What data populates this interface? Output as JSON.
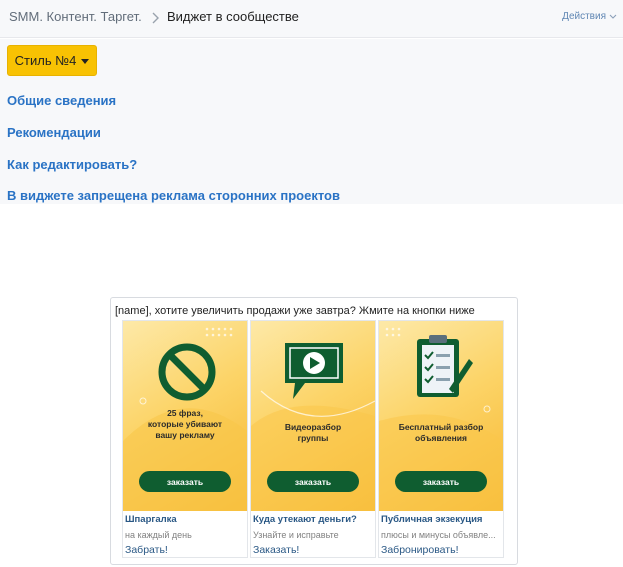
{
  "header": {
    "breadcrumb_parent": "SMM. Контент. Таргет.",
    "breadcrumb_current": "Виджет в сообществе",
    "actions_label": "Действия"
  },
  "style_button": {
    "label": "Стиль №4"
  },
  "sections": [
    {
      "label": "Общие сведения"
    },
    {
      "label": "Рекомендации"
    },
    {
      "label": "Как редактировать?"
    },
    {
      "label": "В виджете запрещена реклама сторонних проектов"
    }
  ],
  "widget": {
    "title": "[name], хотите увеличить продажи уже завтра? Жмите на кнопки ниже",
    "cards": [
      {
        "icon": "no-sign-icon",
        "caption": [
          "25 фраз,",
          "которые убивают",
          "вашу рекламу"
        ],
        "order_label": "заказать",
        "name": "Шпаргалка",
        "description": "на каждый день",
        "link": "Забрать!"
      },
      {
        "icon": "video-play-icon",
        "caption": [
          "Видеоразбор",
          "группы"
        ],
        "order_label": "заказать",
        "name": "Куда утекают деньги?",
        "description": "Узнайте и исправьте",
        "link": "Заказать!"
      },
      {
        "icon": "clipboard-checklist-icon",
        "caption": [
          "Бесплатный разбор",
          "объявления"
        ],
        "order_label": "заказать",
        "name": "Публичная экзекуция",
        "description": "плюсы и минусы объявле...",
        "link": "Забронировать!"
      }
    ]
  },
  "colors": {
    "accent_yellow": "#f8c203",
    "link_blue": "#2a73c5",
    "vk_blue": "#2a5885",
    "dark_green": "#0f5d30"
  }
}
